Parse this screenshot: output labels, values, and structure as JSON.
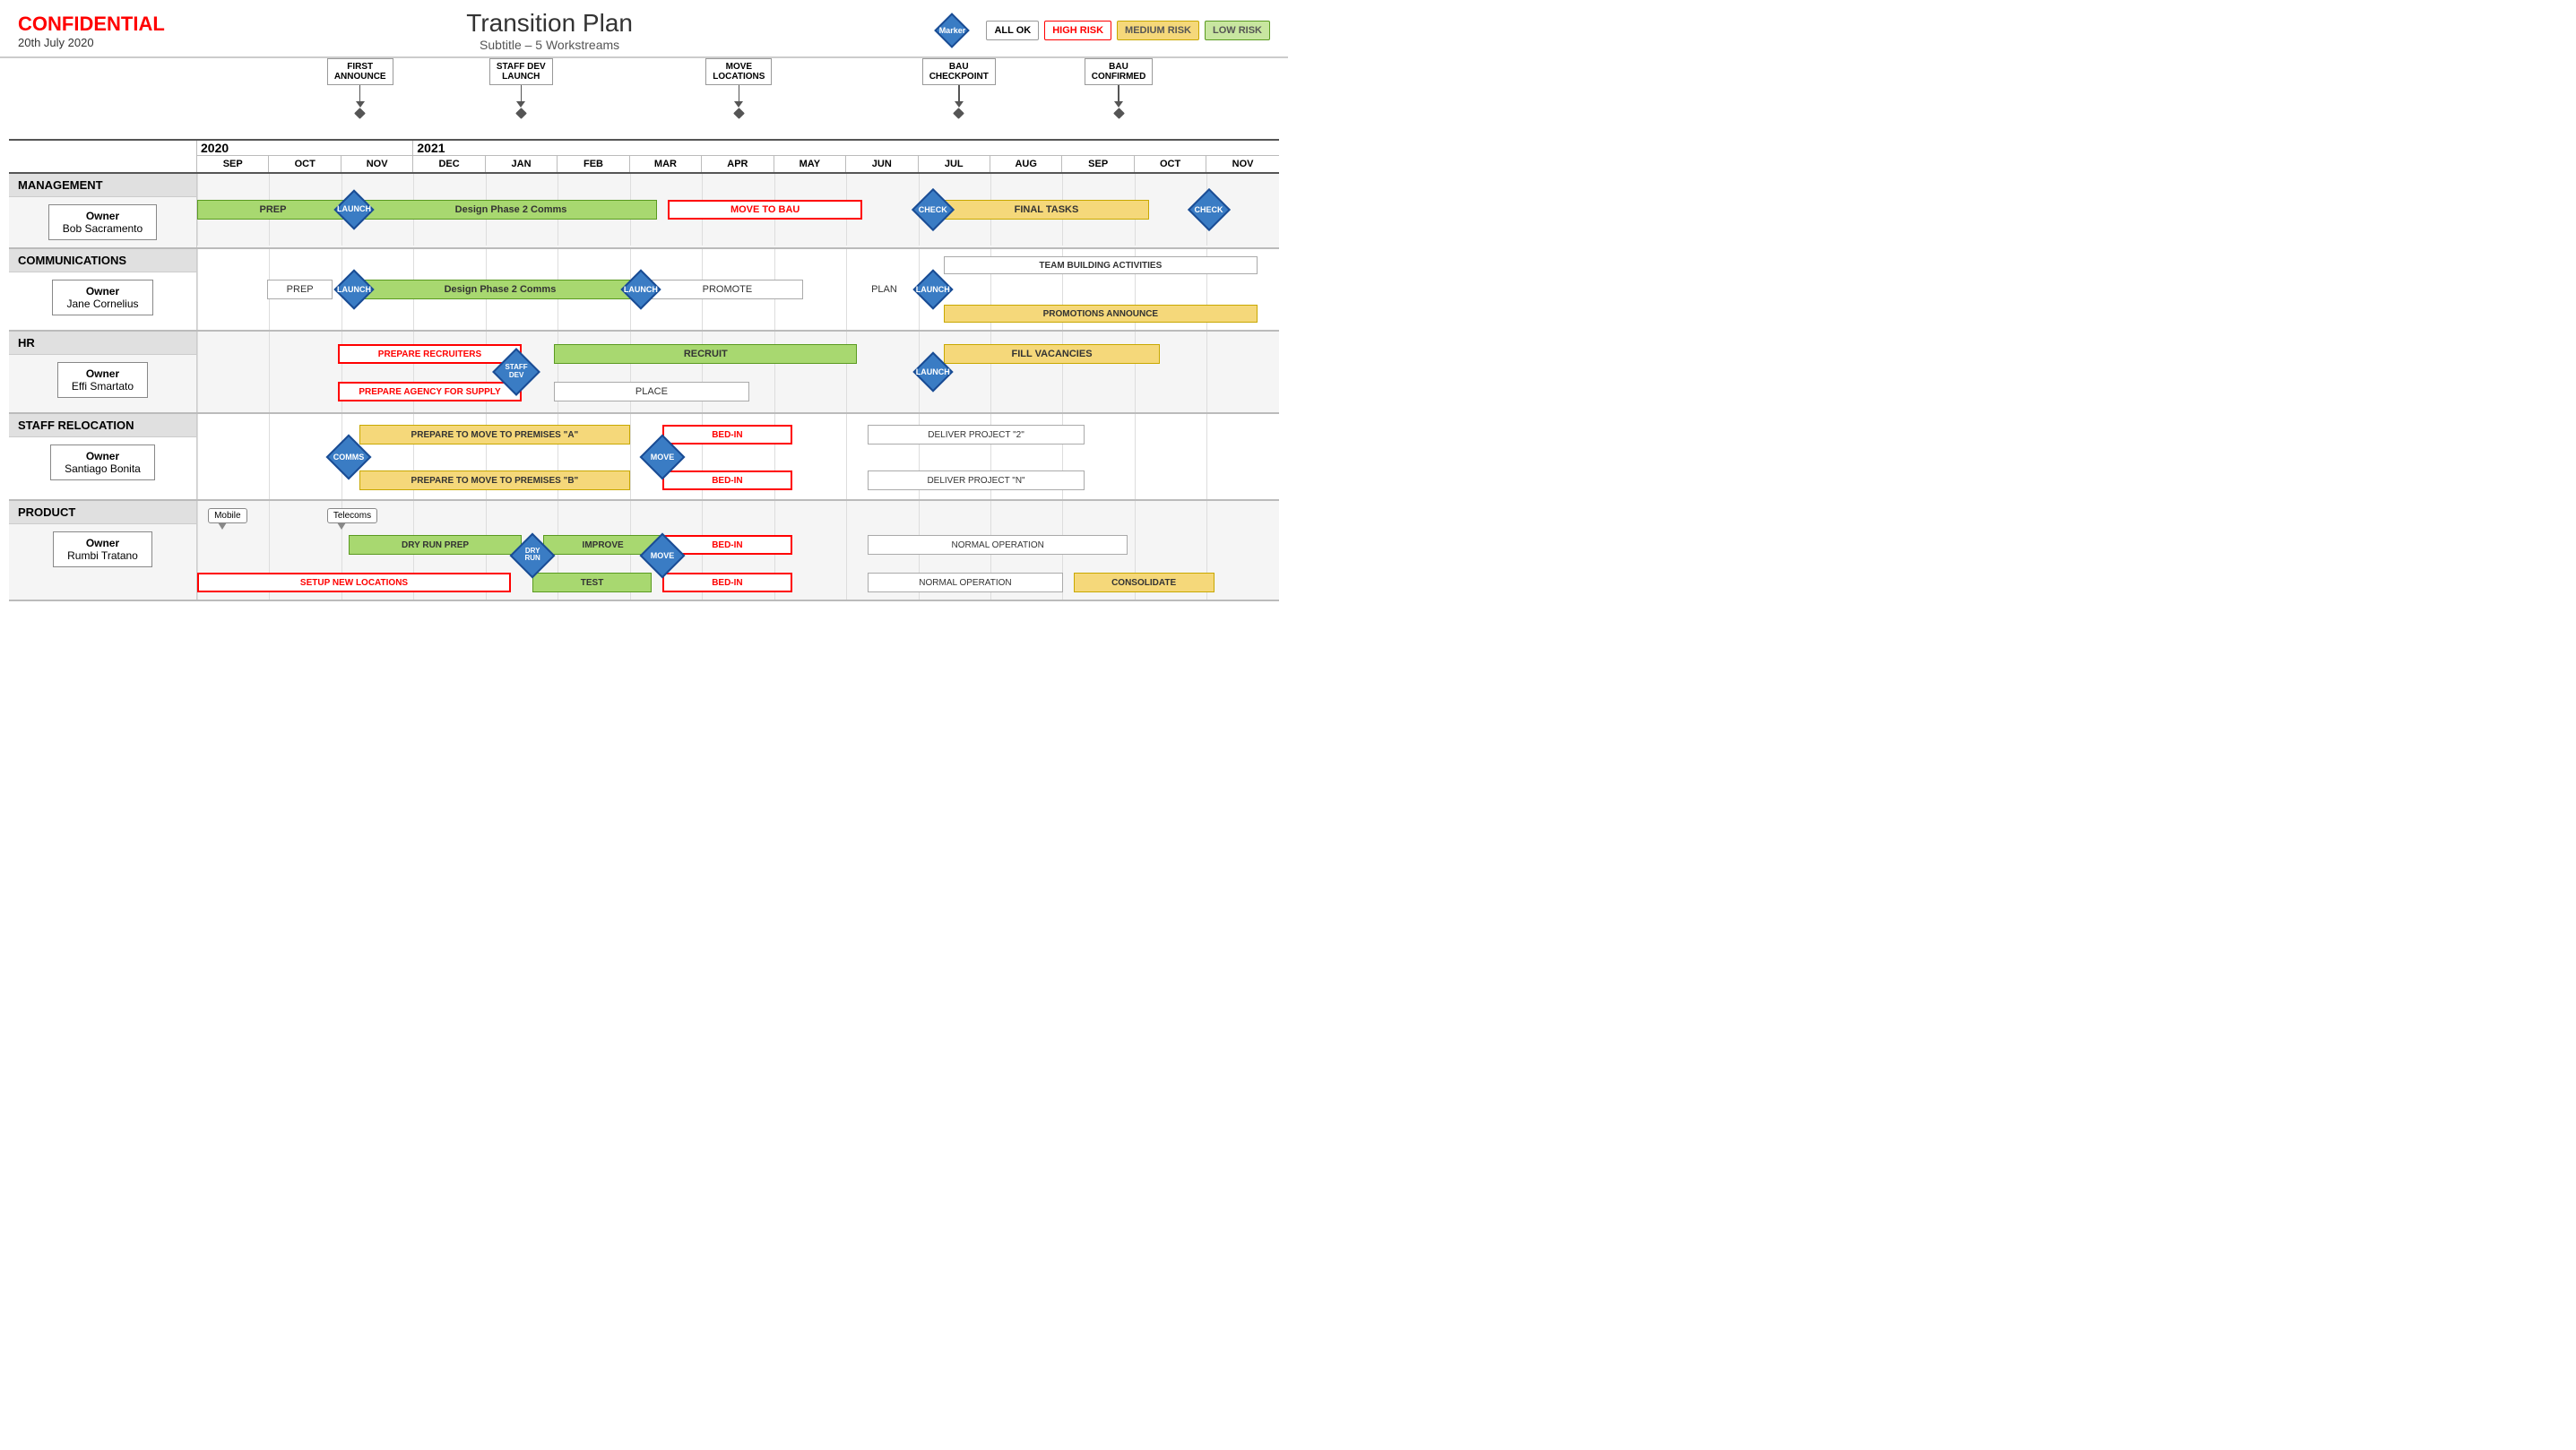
{
  "header": {
    "confidential": "CONFIDENTIAL",
    "date": "20th July 2020",
    "title": "Transition Plan",
    "subtitle": "Subtitle – 5 Workstreams",
    "marker_label": "Marker",
    "legend": {
      "all_ok": "ALL OK",
      "high_risk": "HIGH RISK",
      "medium_risk": "MEDIUM RISK",
      "low_risk": "LOW RISK"
    }
  },
  "milestones": [
    {
      "label": "FIRST\nANNOUNCE",
      "position": 18.5
    },
    {
      "label": "STAFF DEV\nLAUNCH",
      "position": 29.5
    },
    {
      "label": "MOVE\nLOCATIONS",
      "position": 49.5
    },
    {
      "label": "BAU\nCHECKPOINT",
      "position": 70.5
    },
    {
      "label": "BAU\nCONFIRMED",
      "position": 84.5
    }
  ],
  "years": [
    {
      "label": "2020",
      "months": [
        "SEP",
        "OCT",
        "NOV"
      ]
    },
    {
      "label": "2021",
      "months": [
        "DEC",
        "JAN",
        "FEB",
        "MAR",
        "APR",
        "MAY",
        "JUN",
        "JUL",
        "AUG",
        "SEP",
        "OCT",
        "NOV"
      ]
    }
  ],
  "months": [
    "SEP",
    "OCT",
    "NOV",
    "DEC",
    "JAN",
    "FEB",
    "MAR",
    "APR",
    "MAY",
    "JUN",
    "JUL",
    "AUG",
    "SEP",
    "OCT",
    "NOV"
  ],
  "workstreams": [
    {
      "id": "management",
      "title": "MANAGEMENT",
      "owner_label": "Owner",
      "owner_name": "Bob Sacramento",
      "rows": 1
    },
    {
      "id": "communications",
      "title": "COMMUNICATIONS",
      "owner_label": "Owner",
      "owner_name": "Jane Cornelius",
      "rows": 1
    },
    {
      "id": "hr",
      "title": "HR",
      "owner_label": "Owner",
      "owner_name": "Effi Smartato",
      "rows": 2
    },
    {
      "id": "staff_relocation",
      "title": "STAFF RELOCATION",
      "owner_label": "Owner",
      "owner_name": "Santiago Bonita",
      "rows": 2
    },
    {
      "id": "product",
      "title": "PRODUCT",
      "owner_label": "Owner",
      "owner_name": "Rumbi Tratano",
      "rows": 2
    }
  ]
}
